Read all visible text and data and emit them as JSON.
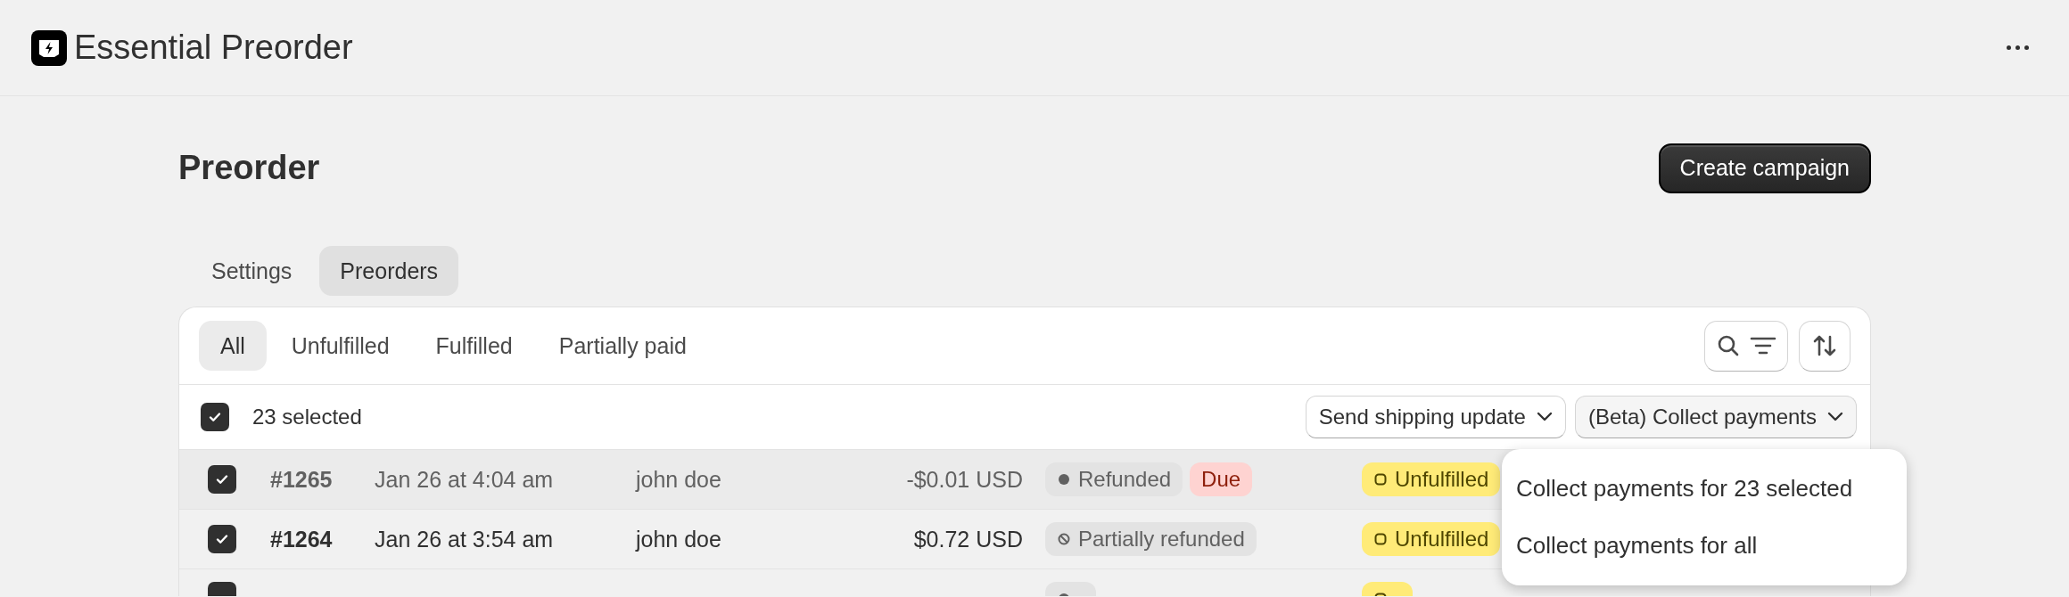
{
  "app": {
    "title": "Essential Preorder"
  },
  "page": {
    "title": "Preorder",
    "primary_action": "Create campaign"
  },
  "tabs": [
    {
      "label": "Settings",
      "selected": false
    },
    {
      "label": "Preorders",
      "selected": true
    }
  ],
  "filters": [
    {
      "label": "All",
      "selected": true
    },
    {
      "label": "Unfulfilled",
      "selected": false
    },
    {
      "label": "Fulfilled",
      "selected": false
    },
    {
      "label": "Partially paid",
      "selected": false
    }
  ],
  "bulk": {
    "checked": true,
    "label": "23 selected",
    "actions": [
      "Send shipping update",
      "(Beta) Collect payments"
    ]
  },
  "rows": [
    {
      "checked": true,
      "dimmed": true,
      "order": "#1265",
      "date": "Jan 26 at 4:04 am",
      "customer": "john doe",
      "total": "-$0.01 USD",
      "payment": [
        {
          "label": "Refunded",
          "kind": "refunded"
        },
        {
          "label": "Due",
          "kind": "due"
        }
      ],
      "fulfillment": {
        "label": "Unfulfilled",
        "kind": "unfulfilled"
      }
    },
    {
      "checked": true,
      "dimmed": false,
      "order": "#1264",
      "date": "Jan 26 at 3:54 am",
      "customer": "john doe",
      "total": "$0.72 USD",
      "payment": [
        {
          "label": "Partially refunded",
          "kind": "partially_refunded"
        }
      ],
      "fulfillment": {
        "label": "Unfulfilled",
        "kind": "unfulfilled"
      }
    },
    {
      "checked": true,
      "dimmed": false,
      "payment": [
        {
          "kind": "refunded"
        }
      ],
      "fulfillment": {
        "kind": "unfulfilled"
      }
    }
  ],
  "menu": {
    "items": [
      "Collect payments for 23 selected",
      "Collect payments for all"
    ]
  }
}
